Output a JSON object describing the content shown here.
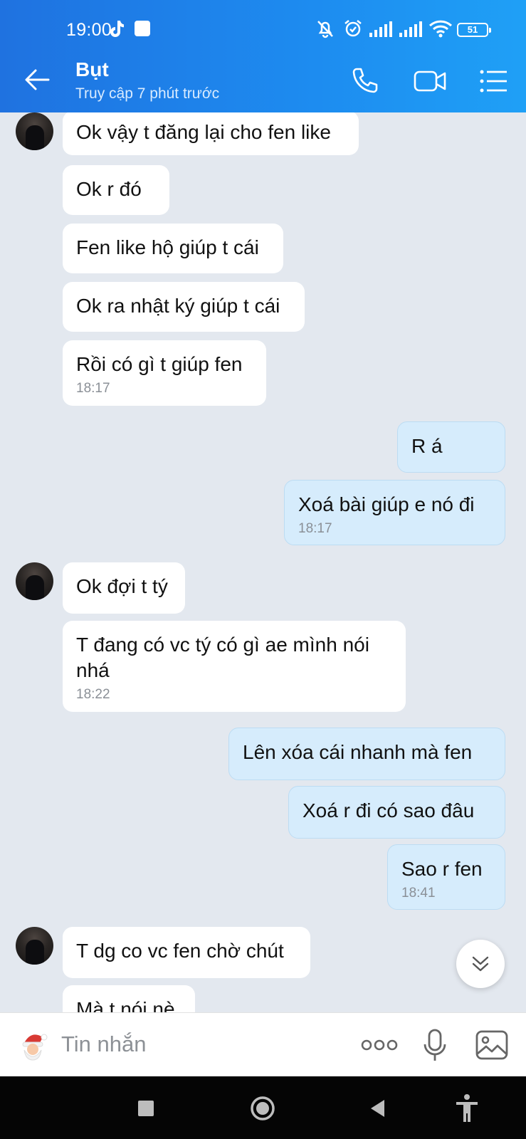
{
  "status_bar": {
    "time": "19:00",
    "battery": "51",
    "icons": [
      "tiktok-icon",
      "app-square-icon",
      "mute-icon",
      "alarm-icon",
      "signal-icon",
      "signal-icon",
      "wifi-icon",
      "battery-icon"
    ]
  },
  "header": {
    "name": "Bụt",
    "last_seen": "Truy cập 7 phút trước",
    "icons": [
      "back-arrow-icon",
      "phone-icon",
      "video-call-icon",
      "menu-list-icon"
    ]
  },
  "messages": [
    {
      "side": "in",
      "text": "Ok vậy t đăng lại cho fen like",
      "time": ""
    },
    {
      "side": "in",
      "text": "Ok r đó",
      "time": ""
    },
    {
      "side": "in",
      "text": "Fen like hộ giúp t cái",
      "time": ""
    },
    {
      "side": "in",
      "text": "Ok ra nhật ký giúp t cái",
      "time": ""
    },
    {
      "side": "in",
      "text": "Rồi có gì t giúp fen",
      "time": "18:17"
    },
    {
      "side": "out",
      "text": "R á",
      "time": ""
    },
    {
      "side": "out",
      "text": "Xoá bài giúp e nó đi",
      "time": "18:17"
    },
    {
      "side": "in",
      "text": "Ok đợi t tý",
      "time": ""
    },
    {
      "side": "in",
      "text": "T đang có vc tý có gì ae mình nói",
      "text2": "nhá",
      "time": "18:22"
    },
    {
      "side": "out",
      "text": "Lên xóa cái nhanh mà fen",
      "time": ""
    },
    {
      "side": "out",
      "text": "Xoá r đi có sao đâu",
      "time": ""
    },
    {
      "side": "out",
      "text": "Sao r fen",
      "time": "18:41"
    },
    {
      "side": "in",
      "text": "T dg co vc fen chờ chút",
      "time": ""
    },
    {
      "side": "in",
      "text": "Mà t nói nè",
      "time": ""
    }
  ],
  "input": {
    "placeholder": "Tin nhắn",
    "icons": [
      "santa-sticker-icon",
      "more-dots-icon",
      "microphone-icon",
      "image-icon"
    ]
  },
  "nav": {
    "icons": [
      "recents-square-icon",
      "home-circle-icon",
      "back-triangle-icon",
      "accessibility-icon"
    ]
  },
  "colors": {
    "header_start": "#1f72e0",
    "header_end": "#1fa0f6",
    "chat_bg": "#e3e8ef",
    "bubble_in": "#ffffff",
    "bubble_out": "#d6ecfc"
  }
}
